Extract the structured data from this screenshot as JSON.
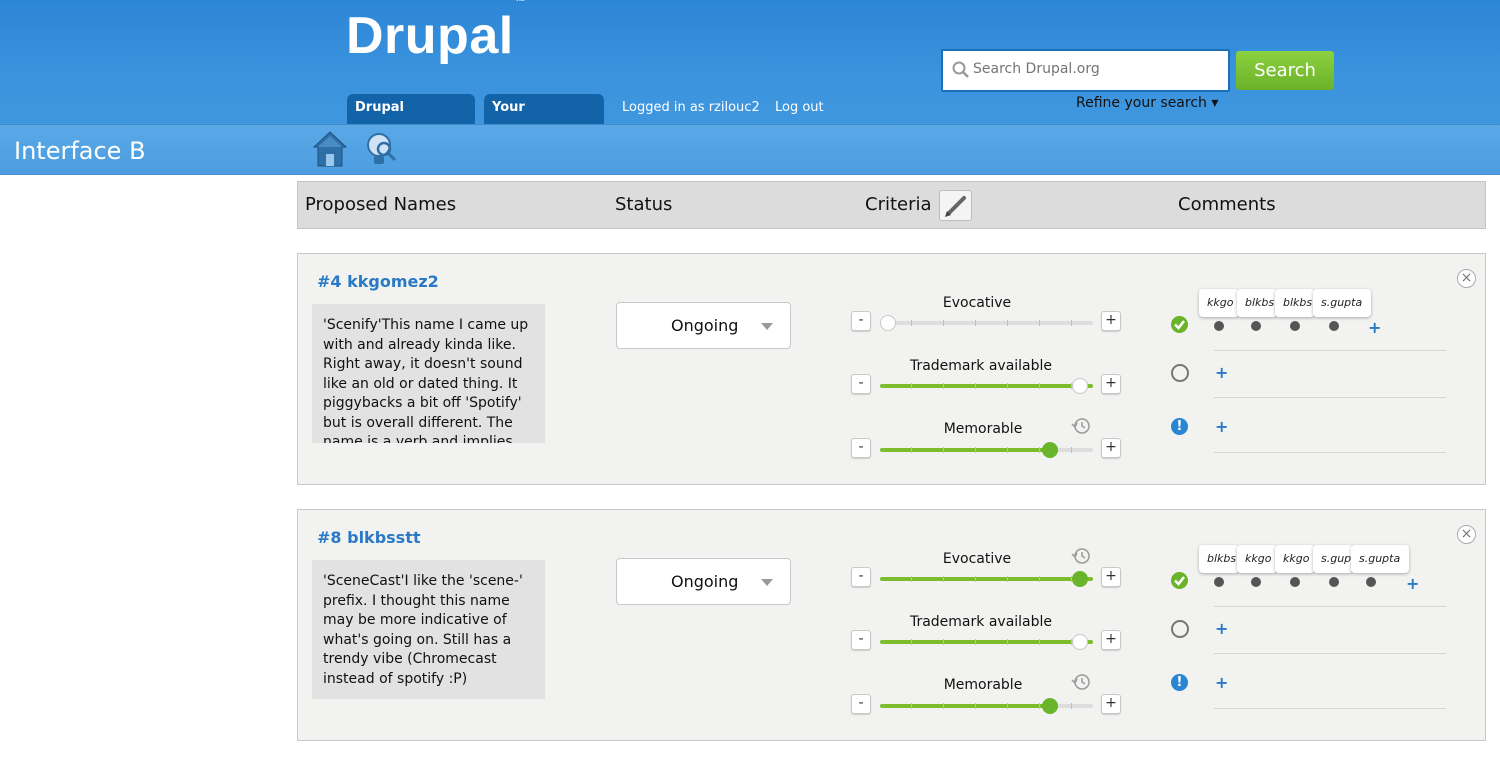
{
  "header": {
    "logo": "Drupal",
    "logo_tm": "™",
    "tabs": [
      "Drupal Homepage",
      "Your Dashboard"
    ],
    "logged_in": "Logged in as rzilouc2",
    "logout": "Log out",
    "search_placeholder": "Search Drupal.org",
    "search_button": "Search",
    "refine": "Refine your search ▾"
  },
  "subbar": {
    "title": "Interface B"
  },
  "columns": {
    "names": "Proposed Names",
    "status": "Status",
    "criteria": "Criteria",
    "comments": "Comments"
  },
  "cards": [
    {
      "title": "#4 kkgomez2",
      "description": "'Scenify'This name I came up with and already kinda like. Right away, it doesn't sound like an old or dated thing. It piggybacks a bit off 'Spotify' but is overall different. The name is a verb and implies",
      "status": "Ongoing",
      "criteria": [
        {
          "label": "Evocative",
          "value": 0.0
        },
        {
          "label": "Trademark available",
          "value": 1.0
        },
        {
          "label": "Memorable",
          "value": 0.8
        }
      ],
      "comment_users": [
        "kkgo",
        "blkbs",
        "blkbs",
        "s.gupta"
      ]
    },
    {
      "title": "#8 blkbsstt",
      "description": "'SceneCast'I like the 'scene-' prefix. I thought this name may be more indicative of what's going on. Still has a trendy vibe (Chromecast instead of spotify :P)",
      "status": "Ongoing",
      "criteria": [
        {
          "label": "Evocative",
          "value": 1.0
        },
        {
          "label": "Trademark available",
          "value": 1.0
        },
        {
          "label": "Memorable",
          "value": 0.8
        }
      ],
      "comment_users": [
        "blkbs",
        "kkgo",
        "kkgo",
        "s.gup",
        "s.gupta"
      ]
    }
  ],
  "colors": {
    "brand_blue": "#2c86d6",
    "accent_green": "#6ab42b",
    "link_blue": "#2a79c5"
  }
}
